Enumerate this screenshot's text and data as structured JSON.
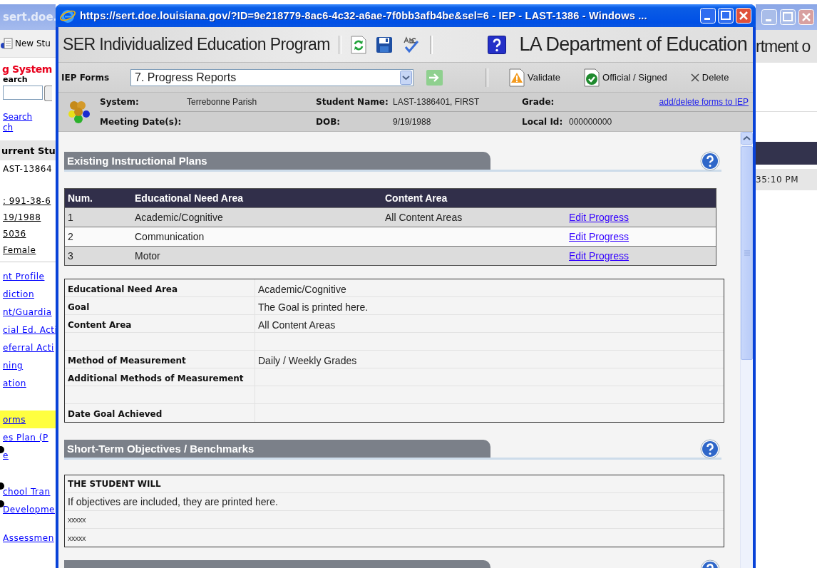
{
  "background_window": {
    "title": "sert.doe.",
    "toolbar_button": "New Stu",
    "app_name": "g System",
    "search_label": "earch",
    "search_links": [
      "Search",
      "ch"
    ],
    "current_student": {
      "heading": "urrent Stu",
      "name": "AST-13864",
      "details": [
        ": 991-38-6",
        "19/1988",
        "5036",
        "Female"
      ]
    },
    "nav_links": [
      {
        "label": "nt Profile",
        "selected": false,
        "bullet": false
      },
      {
        "label": "diction",
        "selected": false,
        "bullet": false
      },
      {
        "label": "nt/Guardia",
        "selected": false,
        "bullet": false
      },
      {
        "label": "cial Ed. Acti",
        "selected": false,
        "bullet": false
      },
      {
        "label": "eferral Acti",
        "selected": false,
        "bullet": false
      },
      {
        "label": "ning",
        "selected": false,
        "bullet": false
      },
      {
        "label": "ation",
        "selected": false,
        "bullet": false
      },
      {
        "label": "orms",
        "selected": true,
        "bullet": false
      },
      {
        "label": "es Plan (P",
        "selected": false,
        "bullet": false
      },
      {
        "label": "e",
        "selected": false,
        "bullet": true
      },
      {
        "label": "chool Tran",
        "selected": false,
        "bullet": true
      },
      {
        "label": "Developme",
        "selected": false,
        "bullet": true
      },
      {
        "label": "Assessmen",
        "selected": false,
        "bullet": false
      }
    ],
    "header_text": "rtment o",
    "time": "35:10 PM"
  },
  "popup": {
    "title": "https://sert.doe.louisiana.gov/?ID=9e218779-8ac6-4c32-a6ae-7f0bb3afb4be&sel=6 - IEP - LAST-1386 - Windows ...",
    "app_title": "SER Individualized Education Program",
    "department": "LA Department of Education",
    "forms_label": "IEP Forms",
    "form_select": "7. Progress Reports",
    "actions": [
      {
        "label": "Validate",
        "kind": "validate"
      },
      {
        "label": "Official / Signed",
        "kind": "signed"
      },
      {
        "label": "Delete",
        "kind": "delete"
      }
    ],
    "student_info": [
      [
        {
          "label": "System:",
          "value": "Terrebonne Parish"
        },
        {
          "label": "Student Name:",
          "value": "LAST-1386401, FIRST"
        },
        {
          "label": "Grade:"
        }
      ],
      [
        {
          "label": "Meeting Date(s):"
        },
        {
          "label": "DOB:",
          "value": "9/19/1988"
        },
        {
          "label": "Local Id:",
          "value": "000000000"
        }
      ]
    ],
    "forms_link": "add/delete forms to IEP",
    "sections": [
      {
        "kind": "plans",
        "title": "Existing Instructional Plans",
        "table": {
          "columns": [
            "Num.",
            "Educational Need Area",
            "Content Area"
          ],
          "rows": [
            {
              "num": "1",
              "need_area": "Academic/Cognitive",
              "content_area": "All Content Areas",
              "link": "Edit Progress"
            },
            {
              "num": "2",
              "need_area": "Communication",
              "link": "Edit Progress"
            },
            {
              "num": "3",
              "need_area": "Motor",
              "link": "Edit Progress"
            }
          ]
        },
        "details": [
          {
            "kind": "field",
            "label": "Educational Need Area",
            "value": "Academic/Cognitive"
          },
          {
            "kind": "field",
            "label": "Goal",
            "value": "The Goal is printed here."
          },
          {
            "kind": "field",
            "label": "Content Area",
            "value": "All Content Areas"
          },
          {
            "kind": "blank"
          },
          {
            "kind": "field",
            "label": "Method of Measurement",
            "value": "Daily / Weekly Grades"
          },
          {
            "kind": "field",
            "label": "Additional Methods of Measurement"
          },
          {
            "kind": "blank"
          },
          {
            "kind": "field",
            "label": "Date Goal Achieved"
          }
        ]
      },
      {
        "kind": "objectives",
        "title": "Short-Term Objectives / Benchmarks",
        "heading": "THE STUDENT WILL",
        "lines": [
          {
            "kind": "text",
            "text": "If objectives are included, they are printed here."
          },
          {
            "kind": "placeholder",
            "text": "xxxxx"
          },
          {
            "kind": "placeholder",
            "text": "xxxxx"
          }
        ]
      },
      {
        "kind": "partial"
      }
    ]
  }
}
